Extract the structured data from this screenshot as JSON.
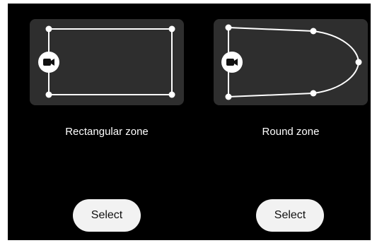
{
  "zones": [
    {
      "id": "rectangular",
      "label": "Rectangular zone",
      "button_label": "Select",
      "icon": "camera-icon"
    },
    {
      "id": "round",
      "label": "Round zone",
      "button_label": "Select",
      "icon": "camera-icon"
    }
  ],
  "colors": {
    "background": "#000000",
    "card": "#2e2e2e",
    "zone_line": "#ffffff",
    "button": "#f2f2f2",
    "button_text": "#111111"
  }
}
